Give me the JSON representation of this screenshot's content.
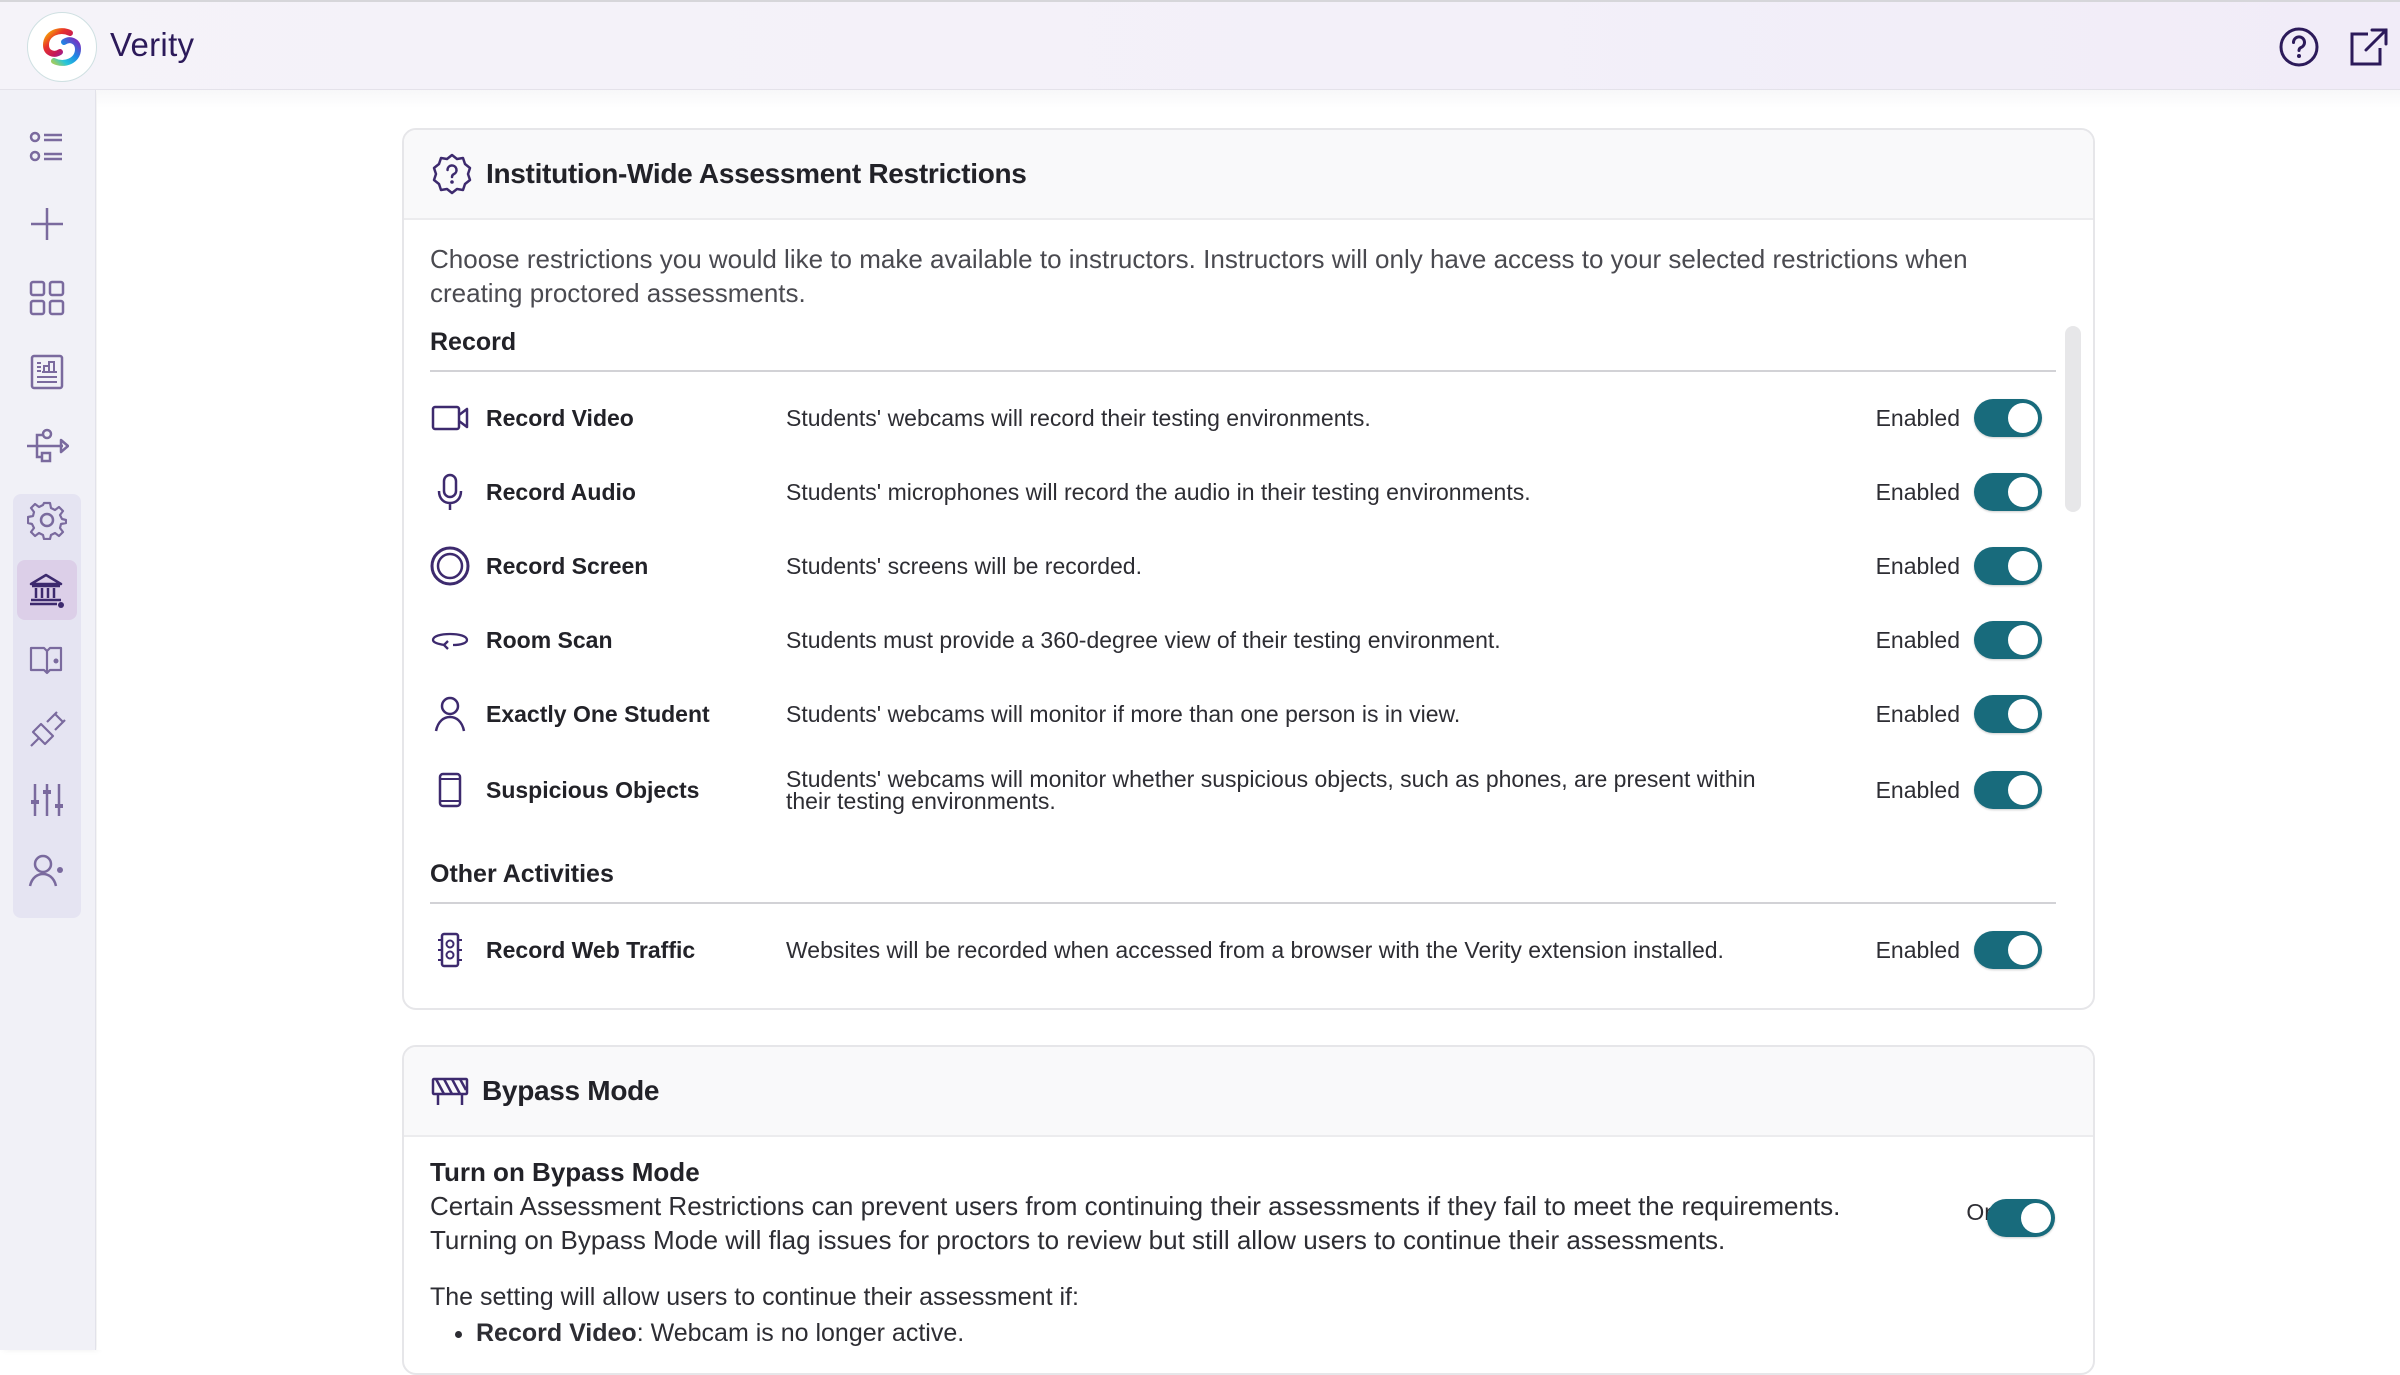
{
  "app": {
    "title": "Verity",
    "colors": {
      "accent": "#186b7c",
      "brand": "#2c1a5a",
      "icon": "#7a6a9e"
    }
  },
  "topbar": {
    "help_icon": "help-circle-icon",
    "external_icon": "external-link-icon"
  },
  "sidebar": {
    "items": [
      {
        "name": "list",
        "icon": "list-icon"
      },
      {
        "name": "add",
        "icon": "plus-icon"
      },
      {
        "name": "dashboard",
        "icon": "grid-icon"
      },
      {
        "name": "reports",
        "icon": "report-icon"
      },
      {
        "name": "integrations",
        "icon": "usb-icon"
      },
      {
        "name": "settings",
        "icon": "gear-icon"
      },
      {
        "name": "institution-settings",
        "icon": "institution-gear-icon",
        "active": true
      },
      {
        "name": "course-settings",
        "icon": "book-gear-icon"
      },
      {
        "name": "plugin-settings",
        "icon": "plug-icon"
      },
      {
        "name": "preferences",
        "icon": "sliders-icon"
      },
      {
        "name": "user-settings",
        "icon": "user-gear-icon"
      }
    ]
  },
  "restrictions_card": {
    "title": "Institution-Wide Assessment Restrictions",
    "intro": "Choose restrictions you would like to make available to instructors. Instructors will only have access to your selected restrictions when creating proctored assessments.",
    "sections": [
      {
        "title": "Record",
        "items": [
          {
            "icon": "video-camera-icon",
            "name": "Record Video",
            "description": "Students' webcams will record their testing environments.",
            "status": "Enabled",
            "enabled": true
          },
          {
            "icon": "microphone-icon",
            "name": "Record Audio",
            "description": "Students' microphones will record the audio in their testing environments.",
            "status": "Enabled",
            "enabled": true
          },
          {
            "icon": "record-screen-icon",
            "name": "Record Screen",
            "description": "Students' screens will be recorded.",
            "status": "Enabled",
            "enabled": true
          },
          {
            "icon": "room-scan-icon",
            "name": "Room Scan",
            "description": "Students must provide a 360-degree view of their testing environment.",
            "status": "Enabled",
            "enabled": true
          },
          {
            "icon": "person-icon",
            "name": "Exactly One Student",
            "description": "Students' webcams will monitor if more than one person is in view.",
            "status": "Enabled",
            "enabled": true
          },
          {
            "icon": "phone-icon",
            "name": "Suspicious Objects",
            "description": "Students' webcams will monitor whether suspicious objects, such as phones, are present within their testing environments.",
            "status": "Enabled",
            "enabled": true
          }
        ]
      },
      {
        "title": "Other Activities",
        "items": [
          {
            "icon": "web-traffic-icon",
            "name": "Record Web Traffic",
            "description": "Websites will be recorded when accessed from a browser with the Verity extension installed.",
            "status": "Enabled",
            "enabled": true
          }
        ]
      }
    ]
  },
  "bypass_card": {
    "title": "Bypass Mode",
    "setting_title": "Turn on Bypass Mode",
    "description": "Certain Assessment Restrictions can prevent users from continuing their assessments if they fail to meet the requirements. Turning on Bypass Mode will flag issues for proctors to review but still allow users to continue their assessments.",
    "status": "On",
    "enabled": true,
    "list_intro": "The setting will allow users to continue their assessment if:",
    "list": [
      {
        "term": "Record Video",
        "text": ": Webcam is no longer active."
      }
    ]
  }
}
